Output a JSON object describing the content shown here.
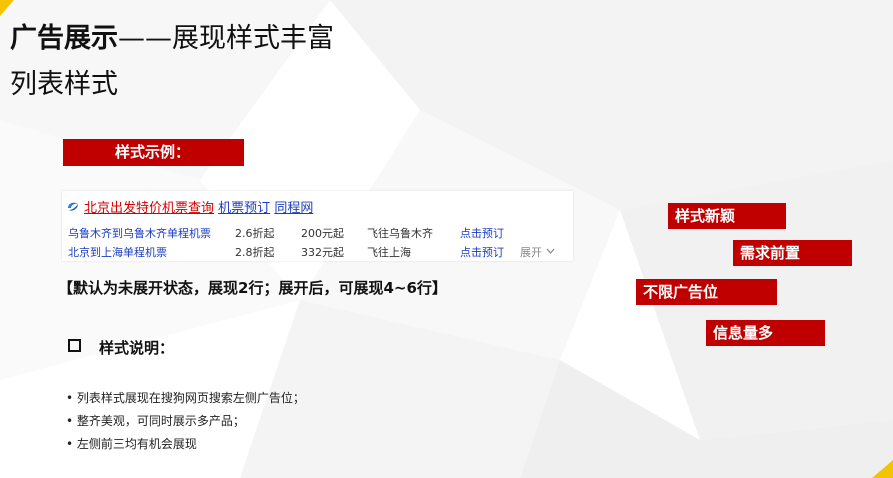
{
  "heading": {
    "bold_part": "广告展示",
    "rest_part": "——展现样式丰富",
    "subtitle": "列表样式"
  },
  "example_label": "样式示例：",
  "ad": {
    "title_red": "北京出发特价机票查询",
    "title_blue1": "机票预订",
    "title_blue2": "同程网",
    "rows": [
      {
        "name": "乌鲁木齐到乌鲁木齐单程机票",
        "discount": "2.6折起",
        "price": "200元起",
        "dest": "飞往乌鲁木齐",
        "action": "点击预订"
      },
      {
        "name": "北京到上海单程机票",
        "discount": "2.8折起",
        "price": "332元起",
        "dest": "飞往上海",
        "action": "点击预订",
        "expand": "展开"
      }
    ]
  },
  "default_note": "【默认为未展开状态，展现2行；展开后，可展现4~6行】",
  "description": {
    "heading": "样式说明：",
    "bullets": [
      "• 列表样式展现在搜狗网页搜索左侧广告位；",
      "• 整齐美观，可同时展示多产品；",
      "• 左侧前三均有机会展现"
    ]
  },
  "tags": [
    "样式新颖",
    "需求前置",
    "不限广告位",
    "信息量多"
  ],
  "colors": {
    "accent_red": "#c00000",
    "link_blue": "#1a3dc1",
    "corner_yellow": "#f5c400"
  }
}
